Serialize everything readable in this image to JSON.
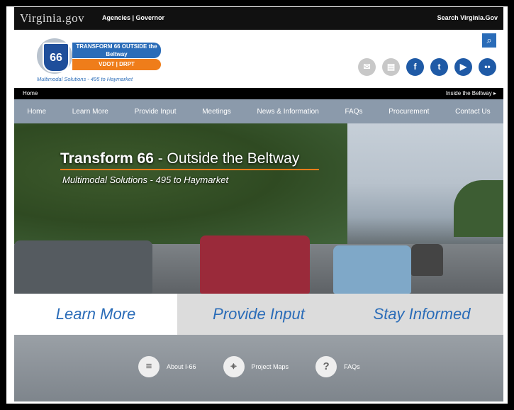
{
  "topbar": {
    "brand": "Virginia.gov",
    "links": "Agencies | Governor",
    "search": "Search Virginia.Gov"
  },
  "logo": {
    "shield_number": "66",
    "banner_top": "TRANSFORM 66 OUTSIDE the Beltway",
    "banner_bottom": "VDOT | DRPT",
    "tagline": "Multimodal Solutions - 495 to Haymarket"
  },
  "social": [
    {
      "name": "email-icon",
      "glyph": "✉"
    },
    {
      "name": "print-icon",
      "glyph": "▤"
    },
    {
      "name": "facebook-icon",
      "glyph": "f"
    },
    {
      "name": "twitter-icon",
      "glyph": "t"
    },
    {
      "name": "youtube-icon",
      "glyph": "▶"
    },
    {
      "name": "flickr-icon",
      "glyph": "••"
    }
  ],
  "homebar": {
    "left": "Home",
    "right": "Inside the Beltway ▸"
  },
  "nav": [
    "Home",
    "Learn More",
    "Provide Input",
    "Meetings",
    "News & Information",
    "FAQs",
    "Procurement",
    "Contact Us"
  ],
  "hero": {
    "title_a": "Transform 66",
    "title_b": " - Outside the Beltway",
    "subtitle": "Multimodal Solutions - 495 to Haymarket"
  },
  "cta": [
    "Learn More",
    "Provide Input",
    "Stay Informed"
  ],
  "quick_links": [
    {
      "label": "About I-66",
      "glyph": "≡"
    },
    {
      "label": "Project Maps",
      "glyph": "⌖"
    },
    {
      "label": "FAQs",
      "glyph": "?"
    }
  ],
  "colors": {
    "brand_blue": "#2a6cb8",
    "accent_orange": "#ef7d1a",
    "nav_grey": "#8b9aab"
  }
}
